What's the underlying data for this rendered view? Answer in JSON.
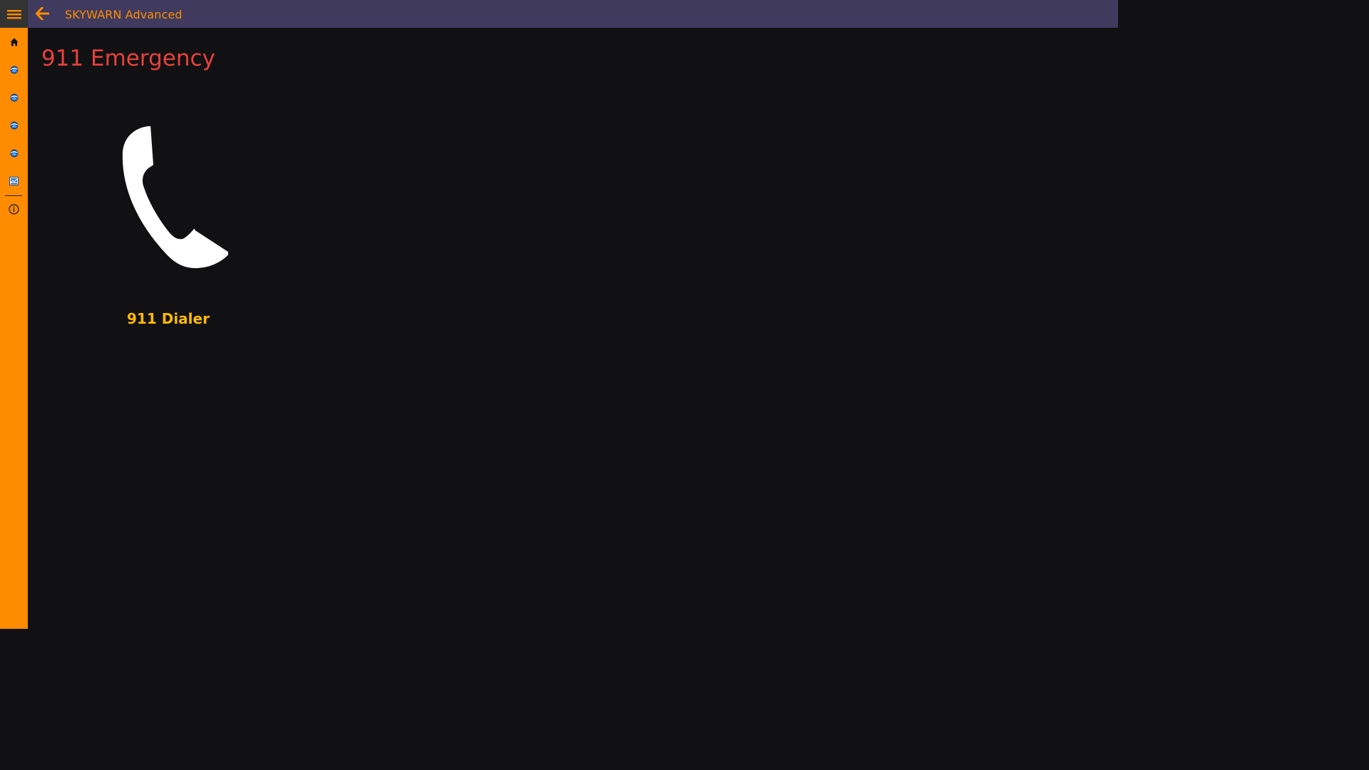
{
  "titlebar": {
    "app_title": "SKYWARN Advanced",
    "back_icon": "back-arrow-icon"
  },
  "rail": {
    "menu_icon": "hamburger-menu-icon",
    "items": [
      {
        "icon": "home-icon"
      },
      {
        "icon": "noaa-logo-icon"
      },
      {
        "icon": "noaa-logo-icon"
      },
      {
        "icon": "noaa-logo-icon"
      },
      {
        "icon": "noaa-logo-icon"
      },
      {
        "icon": "report-icon"
      },
      {
        "icon": "info-icon"
      }
    ]
  },
  "main": {
    "page_title": "911 Emergency",
    "tiles": [
      {
        "label": "911 Dialer",
        "icon": "phone-icon"
      }
    ]
  },
  "colors": {
    "rail": "#ff8c00",
    "titlebar": "#3f3a5e",
    "background": "#111113",
    "page_title": "#e8413c",
    "tile_label": "#ffb900"
  }
}
